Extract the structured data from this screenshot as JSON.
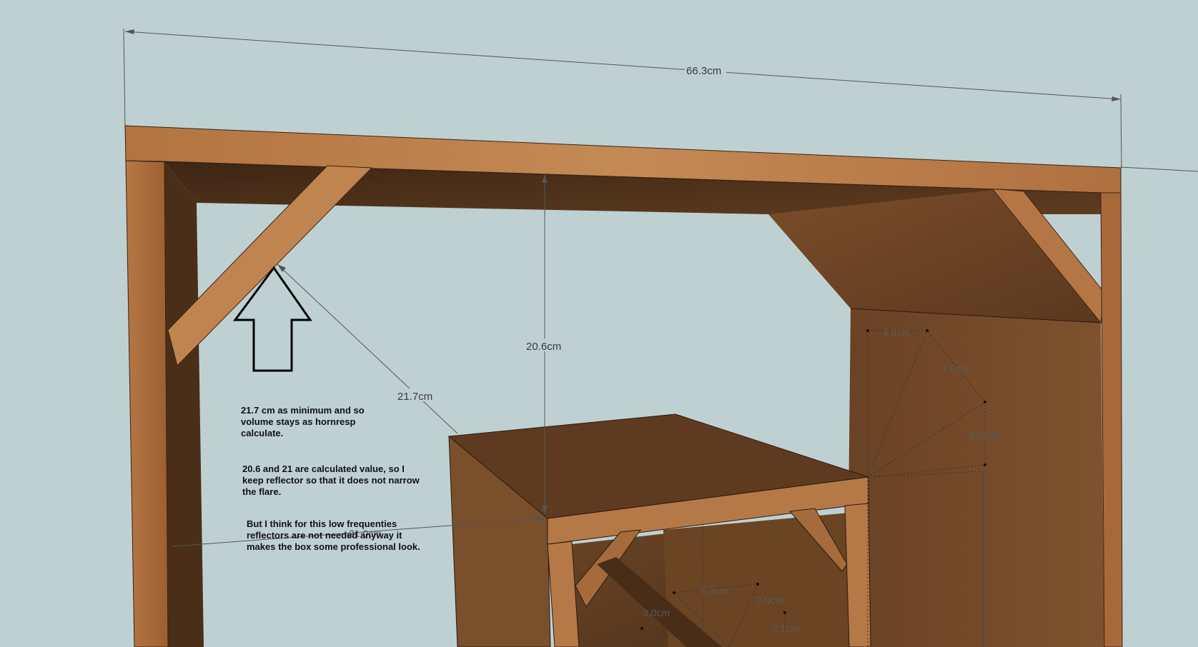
{
  "dimensions": {
    "overall_width": "66.3cm",
    "vertical_gap": "20.6cm",
    "diagonal_gap": "21.7cm",
    "lower_overlay": "21.0cm",
    "segment_top": "4.8cm",
    "segment_diag": "7.0cm",
    "segment_right": "4.6cm",
    "lower_seg_a": "6.0cm",
    "lower_seg_b": "3.0cm",
    "lower_seg_c": "3.0cm",
    "lower_seg_d": "2.1cm"
  },
  "notes": {
    "note_1": "21.7 cm as minimum and so volume stays as hornresp calculate.",
    "note_2": "20.6 and 21 are calculated value, so I keep reflector so that it does not narrow the flare.",
    "note_3": "But I think for this low frequenties reflectors are not needed anyway it makes the box some professional look."
  },
  "colors": {
    "background": "#bfd0d3",
    "wood_light": "#b87a45",
    "wood_dark": "#5a3a22",
    "wood_mid": "#7a4f2c"
  }
}
